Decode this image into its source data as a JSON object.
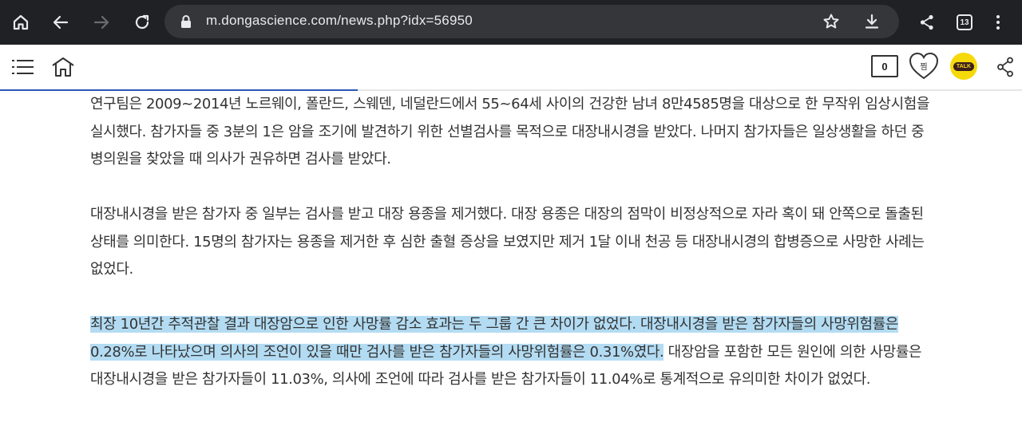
{
  "browser": {
    "url": "m.dongascience.com/news.php?idx=56950",
    "tab_count": "13",
    "icons": [
      "home-icon",
      "back-icon",
      "forward-icon",
      "reload-icon",
      "lock-icon",
      "star-icon",
      "download-icon",
      "share-icon",
      "tab-switcher-icon",
      "menu-icon"
    ]
  },
  "header": {
    "comment_count": "0",
    "like_label": "찜",
    "kakao_label": "TALK",
    "progress_percent": 35
  },
  "article": {
    "p1": "연구팀은 2009~2014년 노르웨이, 폴란드, 스웨덴, 네덜란드에서 55~64세 사이의 건강한 남녀 8만4585명을 대상으로 한 무작위 임상시험을 실시했다. 참가자들 중 3분의 1은 암을 조기에 발견하기 위한 선별검사를 목적으로 대장내시경을 받았다. 나머지 참가자들은 일상생활을 하던 중 병의원을 찾았을 때 의사가 권유하면 검사를 받았다.",
    "p2": "대장내시경을 받은 참가자 중 일부는 검사를 받고 대장 용종을 제거했다. 대장 용종은 대장의 점막이 비정상적으로 자라 혹이 돼 안쪽으로 돌출된 상태를 의미한다. 15명의 참가자는 용종을 제거한 후 심한 출혈 증상을 보였지만 제거 1달 이내 천공 등 대장내시경의 합병증으로 사망한 사례는 없었다.",
    "p3_highlight": "최장 10년간 추적관찰 결과 대장암으로 인한 사망률 감소 효과는 두 그룹 간 큰 차이가 없었다. 대장내시경을 받은 참가자들의 사망위험률은 0.28%로 나타났으며 의사의 조언이 있을 때만 검사를 받은 참가자들의 사망위험률은 0.31%였다.",
    "p3_rest": " 대장암을 포함한 모든 원인에 의한 사망률은 대장내시경을 받은 참가자들이 11.03%, 의사에 조언에 따라 검사를 받은 참가자들이 11.04%로 통계적으로 유의미한 차이가 없었다."
  },
  "colors": {
    "chrome_bg": "#202124",
    "urlbar_bg": "#35363a",
    "highlight": "#b3dcf3",
    "progress": "#2b55b7",
    "kakao": "#f6d90b"
  }
}
